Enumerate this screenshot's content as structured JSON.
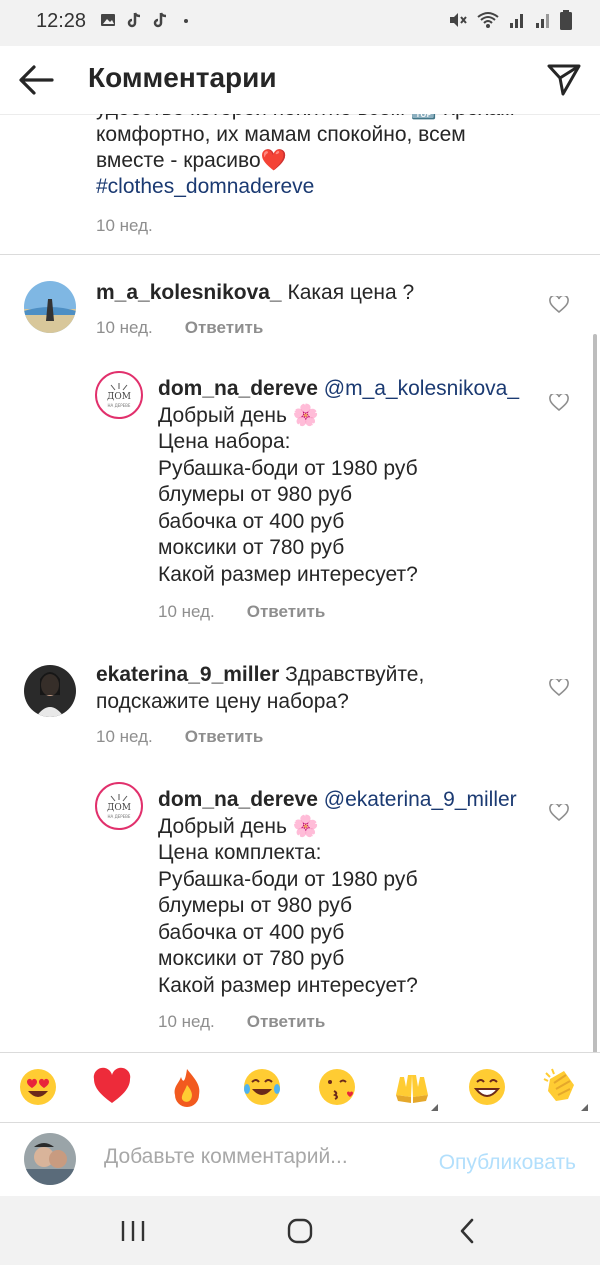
{
  "status_bar": {
    "time": "12:28",
    "left_icons": [
      "image-icon",
      "tiktok-icon",
      "tiktok-icon",
      "dot-icon"
    ],
    "right_icons": [
      "mute-icon",
      "wifi-icon",
      "signal-icon",
      "signal-icon",
      "battery-icon"
    ]
  },
  "header": {
    "title": "Комментарии",
    "back_icon": "arrow-left-icon",
    "send_icon": "paper-plane-icon"
  },
  "caption": {
    "line1": "удобство которой понятно всем 🔝 Крохам",
    "line2": "комфортно, их мамам спокойно, всем",
    "line3": "вместе - красиво❤️",
    "hashtag": "#clothes_domnadereve",
    "time": "10 нед."
  },
  "comments": [
    {
      "username": "m_a_kolesnikova_",
      "text": "Какая цена ?",
      "time": "10 нед.",
      "reply_label": "Ответить"
    },
    {
      "username": "dom_na_dereve",
      "mention": "@m_a_kolesnikova_",
      "lines": [
        "Добрый день 🌸",
        "Цена набора:",
        "Рубашка-боди от 1980 руб",
        "блумеры от 980 руб",
        "бабочка от 400 руб",
        "моксики от 780 руб",
        "Какой размер интересует?"
      ],
      "time": "10 нед.",
      "reply_label": "Ответить"
    },
    {
      "username": "ekaterina_9_miller",
      "text_line1": "Здравствуйте,",
      "text_line2": "подскажите цену набора?",
      "time": "10 нед.",
      "reply_label": "Ответить"
    },
    {
      "username": "dom_na_dereve",
      "mention": "@ekaterina_9_miller",
      "lines": [
        "Добрый день 🌸",
        "Цена комплекта:",
        "Рубашка-боди от 1980 руб",
        "блумеры от 980 руб",
        "бабочка от 400 руб",
        "моксики от 780 руб",
        "Какой размер интересует?"
      ],
      "time": "10 нед.",
      "reply_label": "Ответить"
    }
  ],
  "emoji_bar": [
    "😍",
    "❤️",
    "🔥",
    "😂",
    "😘",
    "🙌",
    "😄",
    "👏"
  ],
  "compose": {
    "placeholder": "Добавьте комментарий...",
    "publish_label": "Опубликовать"
  },
  "colors": {
    "link": "#1b3a72",
    "secondary": "#8e8e8e",
    "publish_disabled": "#b2dffc",
    "heart_red": "#ed2b3a"
  }
}
